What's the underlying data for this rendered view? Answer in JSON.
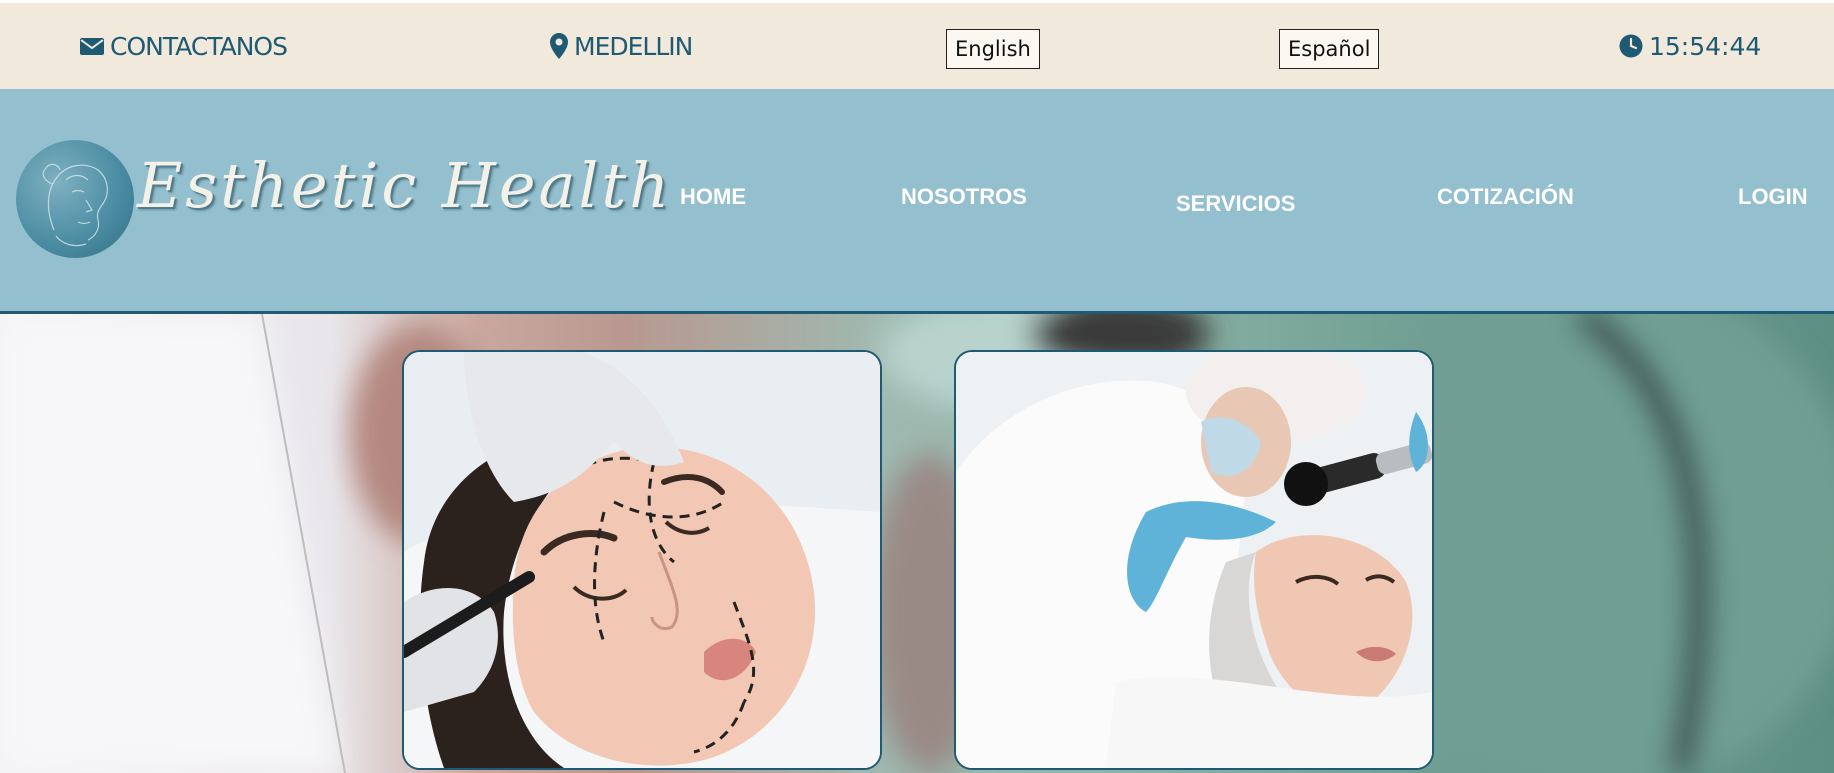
{
  "topbar": {
    "contact_label": "CONTACTANOS",
    "location_label": "MEDELLIN",
    "lang_english": "English",
    "lang_spanish": "Español",
    "clock": "15:54:44",
    "icons": [
      "envelope-icon",
      "map-pin-icon",
      "clock-icon"
    ]
  },
  "brand": {
    "name": "Esthetic Health"
  },
  "nav": {
    "home": "HOME",
    "about": "NOSOTROS",
    "services": "SERVICIOS",
    "quote": "COTIZACIÓN",
    "login": "LOGIN"
  },
  "colors": {
    "topbar_bg": "#f0e9dc",
    "accent": "#1e5a72",
    "navbar_bg": "#94bfcf",
    "nav_text": "#ffffff"
  }
}
